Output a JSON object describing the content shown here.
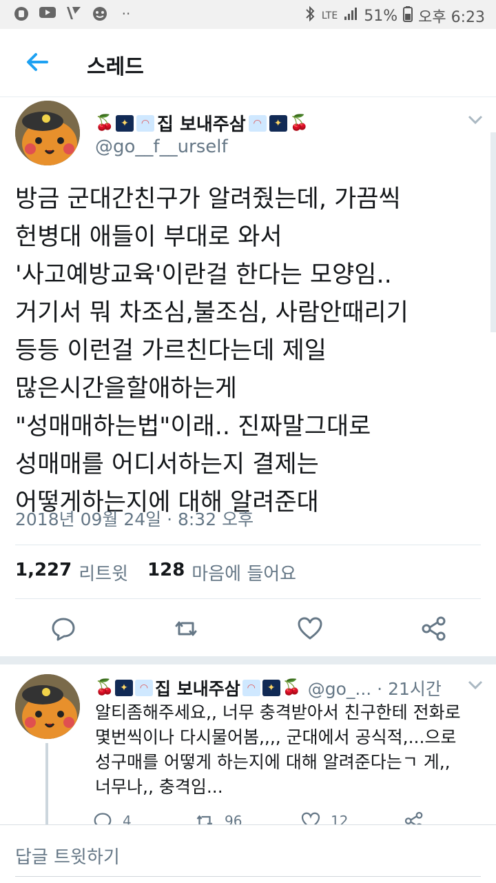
{
  "status_bar": {
    "network": "LTE",
    "battery": "51%",
    "time": "오후 6:23",
    "left_icons": [
      "app-icon",
      "youtube-icon",
      "v-icon",
      "face-icon",
      "more-dots-icon"
    ]
  },
  "header": {
    "title": "스레드"
  },
  "tweet": {
    "display_name": "집 보내주삼",
    "handle": "@go__f__urself",
    "text": "방금 군대간친구가 알려줬는데, 가끔씩\n헌병대 애들이 부대로 와서\n'사고예방교육'이란걸 한다는 모양임..\n거기서 뭐 차조심,불조심, 사람안때리기\n등등 이런걸 가르친다는데 제일\n많은시간을할애하는게\n\"성매매하는법\"이래.. 진짜말그대로\n성매매를 어디서하는지 결제는\n어떻게하는지에 대해 알려준대",
    "date": "2018년 09월 24일 · 8:32 오후",
    "retweets_count": "1,227",
    "retweets_label": "리트윗",
    "likes_count": "128",
    "likes_label": "마음에 들어요"
  },
  "reply": {
    "display_name": "집 보내주삼",
    "handle_time": "@go_... · 21시간",
    "text": "알티좀해주세요,, 너무 충격받아서 친구한테 전화로\n몇번씩이나 다시물어봄,,,, 군대에서 공식적,...으로\n성구매를 어떻게 하는지에 대해 알려준다는ㄱ 게,,\n너무나,, 충격임...",
    "replies": "4",
    "retweets": "96",
    "likes": "12"
  },
  "compose": {
    "placeholder": "답글 트윗하기"
  },
  "colors": {
    "accent": "#1da1f2",
    "secondary_text": "#657786",
    "divider": "#e1e8ed"
  }
}
